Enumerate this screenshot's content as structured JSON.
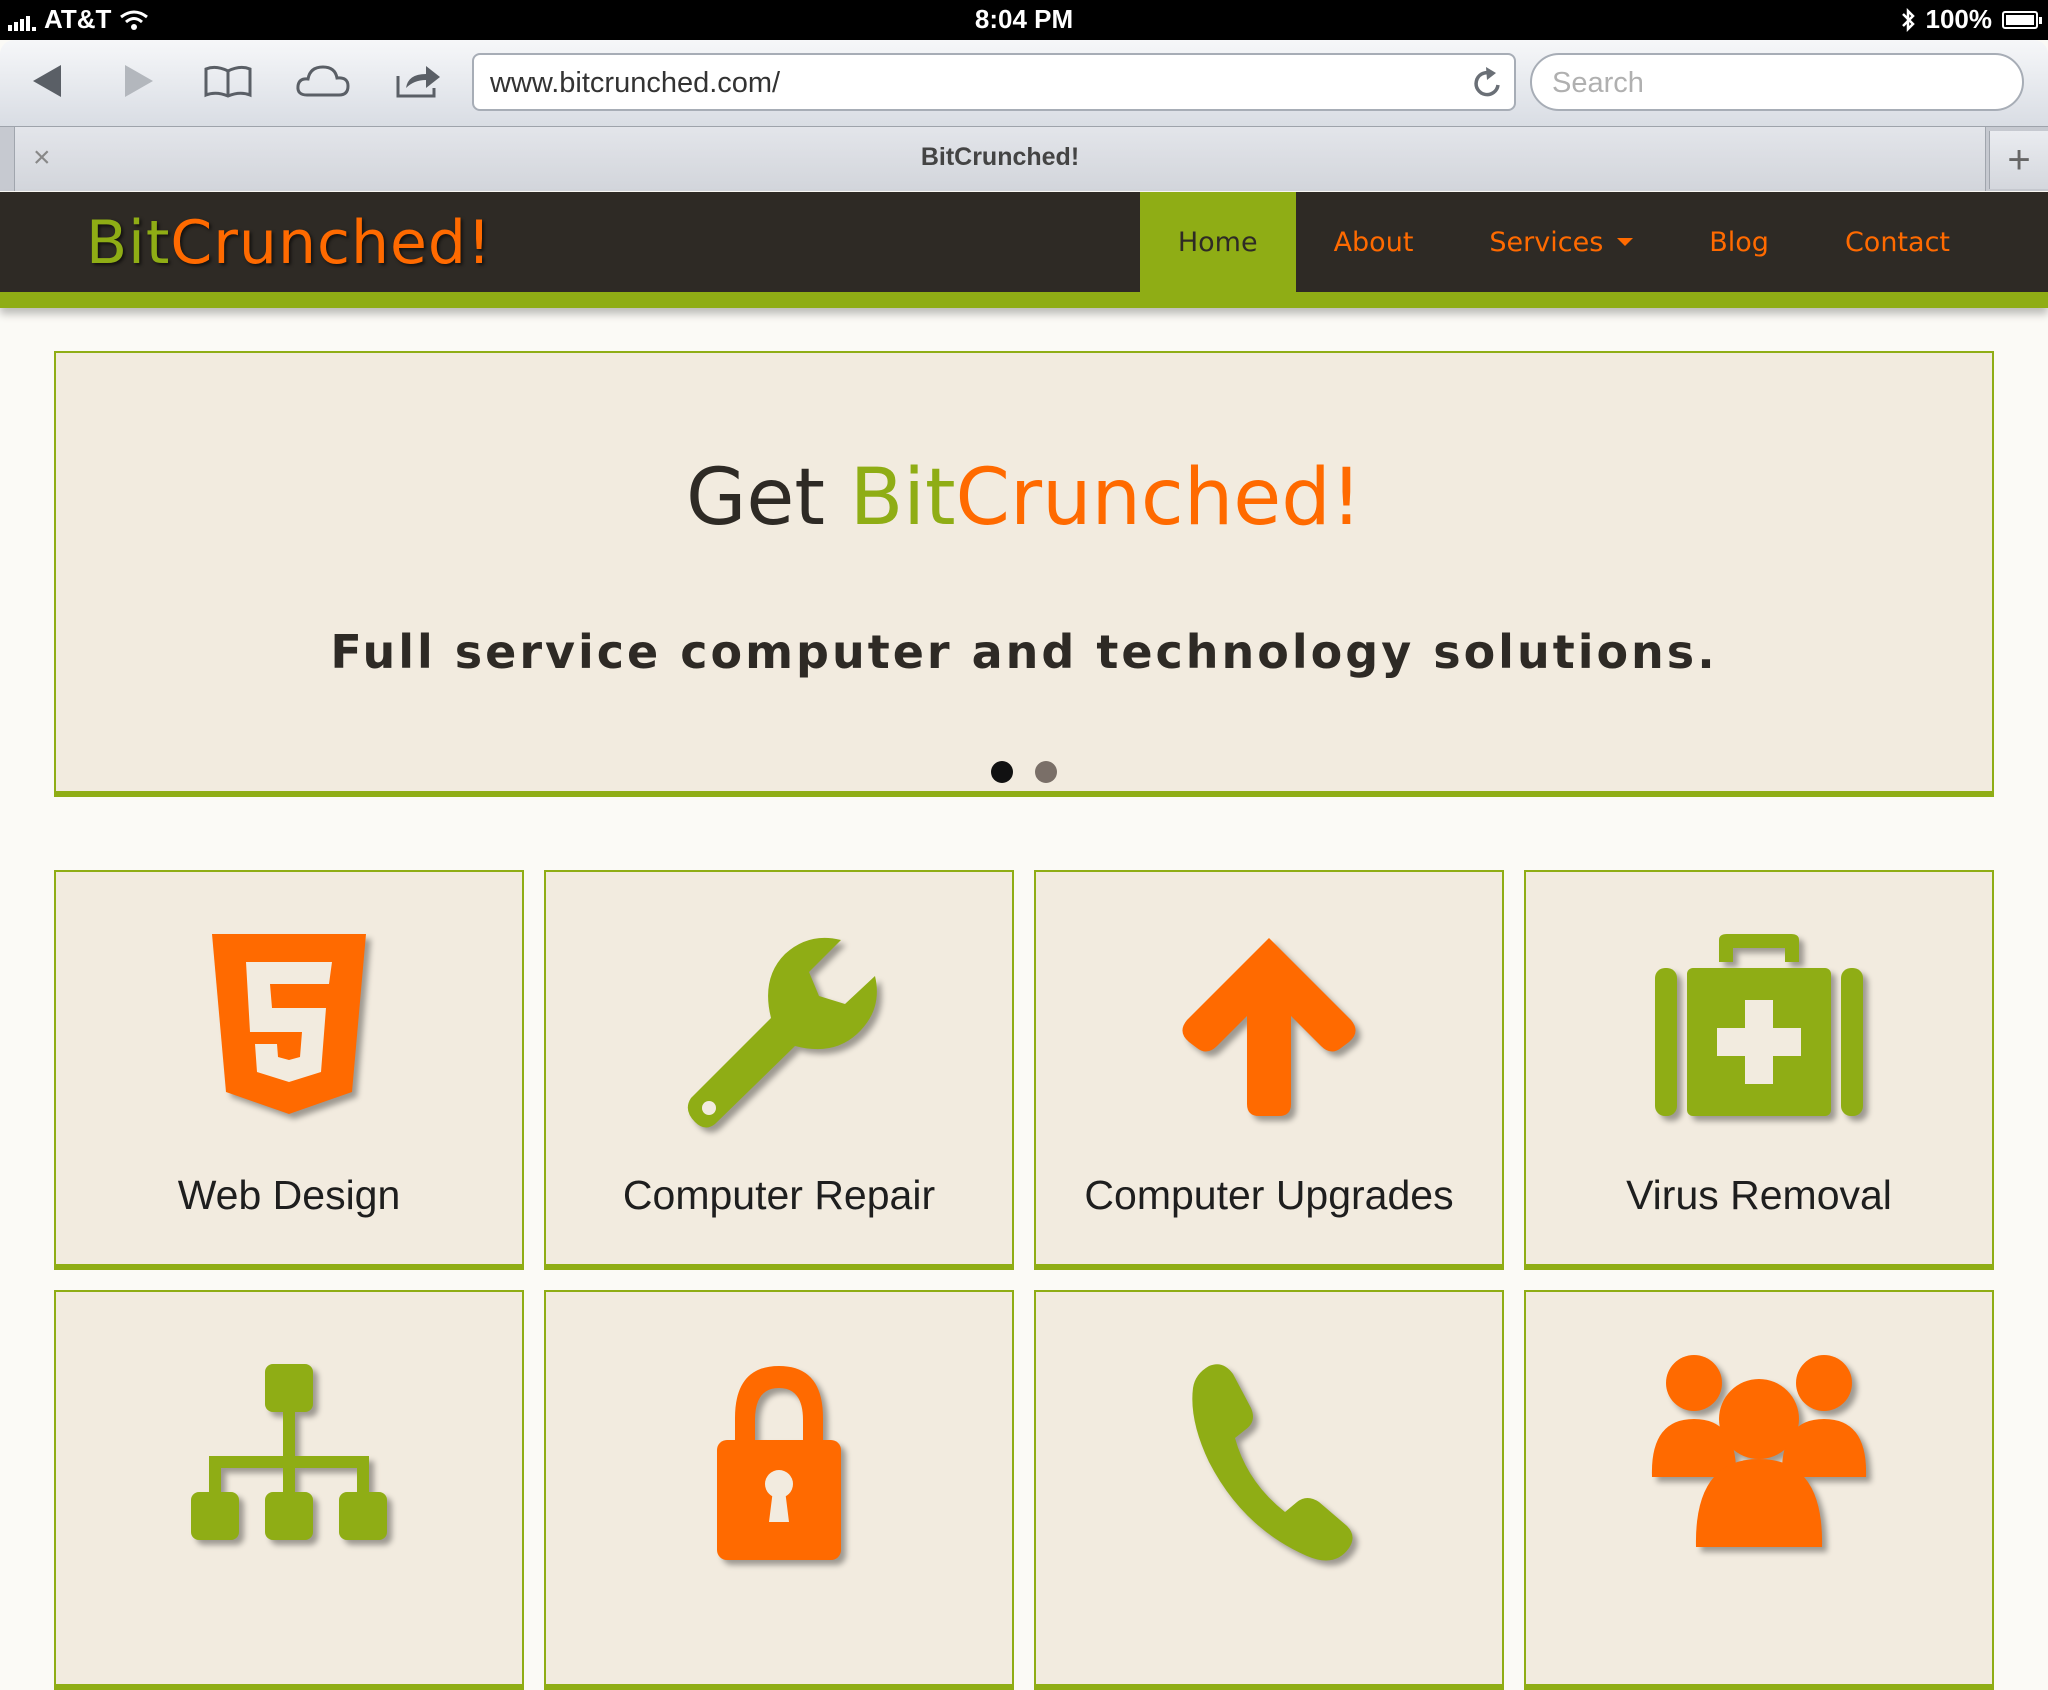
{
  "status_bar": {
    "carrier": "AT&T",
    "time": "8:04 PM",
    "battery": "100%"
  },
  "browser": {
    "url": "www.bitcrunched.com/",
    "search_placeholder": "Search",
    "tab_title": "BitCrunched!",
    "close_glyph": "×",
    "new_tab_glyph": "+"
  },
  "site": {
    "logo": {
      "part1": "Bit",
      "part2": "Crunched!"
    },
    "nav": [
      {
        "label": "Home",
        "active": true
      },
      {
        "label": "About"
      },
      {
        "label": "Services",
        "has_dropdown": true
      },
      {
        "label": "Blog"
      },
      {
        "label": "Contact"
      }
    ],
    "hero": {
      "title_prefix": "Get ",
      "title_part1": "Bit",
      "title_part2": "Crunched!",
      "subtitle": "Full service computer and technology solutions.",
      "slides": 2,
      "active_slide": 1
    },
    "services": [
      {
        "label": "Web Design",
        "icon": "html5-icon"
      },
      {
        "label": "Computer Repair",
        "icon": "wrench-icon"
      },
      {
        "label": "Computer Upgrades",
        "icon": "arrow-up-icon"
      },
      {
        "label": "Virus Removal",
        "icon": "medkit-icon"
      },
      {
        "label": "",
        "icon": "network-icon"
      },
      {
        "label": "",
        "icon": "lock-icon"
      },
      {
        "label": "",
        "icon": "phone-icon"
      },
      {
        "label": "",
        "icon": "group-icon"
      }
    ]
  },
  "colors": {
    "green": "#8fad15",
    "orange": "#ff6a00",
    "dark": "#2e2a25",
    "panel": "#f2ebdf"
  }
}
